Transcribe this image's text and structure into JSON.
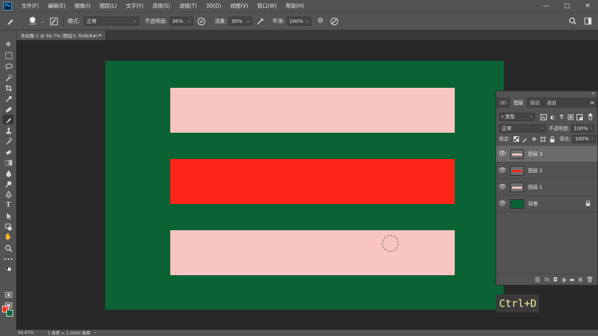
{
  "menubar": {
    "logo": "Ps",
    "items": [
      "文件(F)",
      "编辑(E)",
      "图像(I)",
      "图层(L)",
      "文字(Y)",
      "选择(S)",
      "滤镜(T)",
      "3D(D)",
      "视图(V)",
      "窗口(W)",
      "帮助(H)"
    ],
    "win_controls": [
      "—",
      "□",
      "✕"
    ]
  },
  "options": {
    "brush_size": "100",
    "mode_label": "模式:",
    "mode_value": "正常",
    "opacity_label": "不透明度:",
    "opacity_value": "30%",
    "flow_label": "流量:",
    "flow_value": "30%",
    "smooth_label": "平滑:",
    "smooth_value": "100%"
  },
  "tab": {
    "title": "未标题-1 @ 66.7% (图层3, RGB/8#) *",
    "close": "×"
  },
  "canvas": {
    "background": "#0b6234",
    "stripe_light": "#f8c5c0",
    "stripe_red": "#ff2418"
  },
  "colors": {
    "foreground": "#ff2a1a",
    "background": "#0a6a36"
  },
  "layers_panel": {
    "tabs": [
      "3D",
      "图层",
      "路径",
      "通道"
    ],
    "active_tab": "图层",
    "filter_value": "类型",
    "blend_mode": "正常",
    "opacity_label": "不透明度:",
    "opacity_value": "100%",
    "lock_label": "锁定:",
    "fill_label": "填充:",
    "fill_value": "100%",
    "layers": [
      {
        "name": "图层 3",
        "thumb": "#f8c5c0",
        "selected": true
      },
      {
        "name": "图层 2",
        "thumb": "#ff2418",
        "selected": false
      },
      {
        "name": "图层 1",
        "thumb": "#f8c5c0",
        "selected": false
      },
      {
        "name": "背景",
        "thumb": "#0b6234",
        "selected": false
      }
    ],
    "footer": [
      "⛓",
      "fx",
      "◘",
      "◑",
      "▬",
      "⊞",
      "🗑"
    ]
  },
  "caption": "Ctrl+D",
  "status": {
    "zoom": "66.67%",
    "info": "1 像素 = 1.0000 像素"
  }
}
